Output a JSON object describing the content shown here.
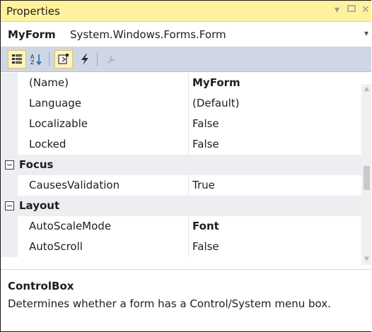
{
  "panel": {
    "title": "Properties",
    "pin_icon": "dropdown-arrow-icon",
    "maximize_icon": "maximize-icon",
    "close_icon": "close-icon"
  },
  "object_selector": {
    "name": "MyForm",
    "type": "System.Windows.Forms.Form"
  },
  "toolbar": {
    "tools": [
      {
        "name": "categorized-icon",
        "active": true
      },
      {
        "name": "alphabetical-icon",
        "active": false
      },
      {
        "name": "properties-icon",
        "active": true
      },
      {
        "name": "events-icon",
        "active": false
      },
      {
        "name": "property-pages-icon",
        "active": false
      }
    ]
  },
  "rows": [
    {
      "kind": "prop",
      "name": "(Name)",
      "value": "MyForm",
      "bold": true
    },
    {
      "kind": "prop",
      "name": "Language",
      "value": "(Default)",
      "bold": false
    },
    {
      "kind": "prop",
      "name": "Localizable",
      "value": "False",
      "bold": false
    },
    {
      "kind": "prop",
      "name": "Locked",
      "value": "False",
      "bold": false
    },
    {
      "kind": "cat",
      "name": "Focus"
    },
    {
      "kind": "prop",
      "name": "CausesValidation",
      "value": "True",
      "bold": false
    },
    {
      "kind": "cat",
      "name": "Layout"
    },
    {
      "kind": "prop",
      "name": "AutoScaleMode",
      "value": "Font",
      "bold": true
    },
    {
      "kind": "prop",
      "name": "AutoScroll",
      "value": "False",
      "bold": false
    }
  ],
  "description": {
    "title": "ControlBox",
    "text": "Determines whether a form has a Control/System menu box."
  },
  "colors": {
    "title_bar": "#fff29d",
    "toolbar": "#cfd6e5",
    "category_row": "#eeeef2"
  }
}
